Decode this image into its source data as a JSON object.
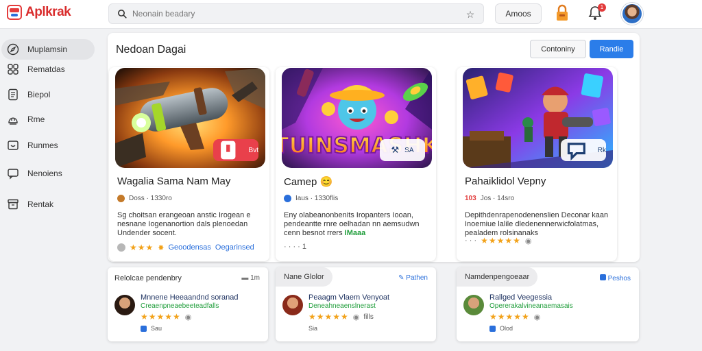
{
  "app": {
    "brand_small": "ᗰᗷᗩᖇ",
    "title": "Aplkrak"
  },
  "search": {
    "placeholder": "Neonain beadary",
    "value": ""
  },
  "topbar": {
    "action_label": "Amoos",
    "notification_count": "1"
  },
  "sidebar": {
    "items": [
      {
        "label": "Muplamsin",
        "icon": "compass-icon",
        "active": true
      },
      {
        "label": "Rematdas",
        "icon": "puzzle-icon",
        "active": false
      },
      {
        "label": "Biepol",
        "icon": "document-icon",
        "active": false
      },
      {
        "label": "Rme",
        "icon": "face-icon",
        "active": false
      },
      {
        "label": "Runmes",
        "icon": "smile-box-icon",
        "active": false
      },
      {
        "label": "Nenoiens",
        "icon": "chat-icon",
        "active": false
      },
      {
        "label": "Rentak",
        "icon": "archive-icon",
        "active": false
      }
    ]
  },
  "panel": {
    "title": "Nedoan Dagai",
    "category_button": "Contoniny",
    "primary_button": "Randie"
  },
  "cards": [
    {
      "title": "Wagalia Sama Nam May",
      "meta": "Doss · 1330ro",
      "desc": "Sg choitsan erangeoan anstic Irogean e nesnane Iogenanortion dals plenoedan Undender socent.",
      "desc_tag": "",
      "pill_label": "Bvt",
      "pill_icon": "bookmark-icon",
      "stars": "★★★",
      "badge_icon": "medal-icon",
      "link1": "Geoodensas",
      "link2": "Oegarinsed"
    },
    {
      "title": "Camep 😊",
      "meta": "Iaus · 1330flis",
      "desc": "Eny olabeanonbenits Iropanters Iooan, pendeantte rnre oelhadan nn aemsudwn cenn besnot rrers",
      "desc_tag": "IMaaa",
      "pill_label": "SA",
      "pill_icon": "tool-icon",
      "foot": "· · · ·   1",
      "art_text": "TUINSMASHK"
    },
    {
      "title": "Pahaiklidol Vepny",
      "meta": "Jos · 14sro",
      "meta_accent": "103",
      "desc": "Depithdenrapenodenenslien Deconar kaan Inoemiue lalile dledenennerwicfolatmas, pealadem rolsinanaks",
      "desc_tag": "",
      "pill_label": "Rk",
      "pill_icon": "chat-bubble-icon",
      "stars": "★★★★★",
      "foot_prefix": "· · ·"
    }
  ],
  "reviews": [
    {
      "heading": "Relolcae pendenbry",
      "action": "1m",
      "name": "Mnnene Heeaandnd soranad",
      "sub": "Creaenpneaebeeteadfalls",
      "stars": "★★★★★",
      "foot": "Sau"
    },
    {
      "heading": "Nane Glolor",
      "action": "Pathen",
      "name": "Peaagm Vlaem Venyoat",
      "sub": "Deneahneaenslnerast",
      "stars": "★★★★★",
      "rating_extra": "fills",
      "foot": "Sia"
    },
    {
      "heading": "Namdenpengoeaar",
      "action": "Peshos",
      "name": "Rallged Veegessia",
      "sub": "Opererakalvineanaemasais",
      "stars": "★★★★★",
      "foot": "Olod"
    }
  ],
  "colors": {
    "brand": "#d92d2d",
    "primary": "#2b7de9",
    "star": "#f2a21a",
    "accent_green": "#1f9d3a",
    "accent_red": "#e9404b"
  }
}
